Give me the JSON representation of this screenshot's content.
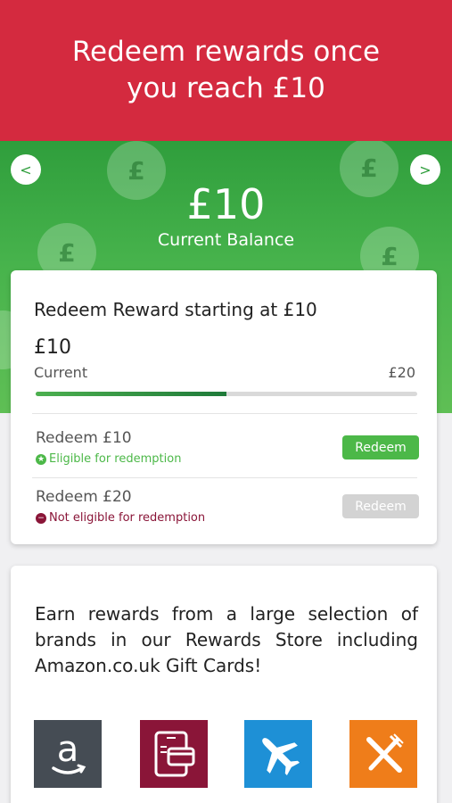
{
  "banner": {
    "title": "Redeem rewards once you reach £10"
  },
  "hero": {
    "prev_label": "<",
    "next_label": ">",
    "balance_amount": "£10",
    "balance_label": "Current Balance",
    "coin_symbol": "£",
    "color": "#47b34c"
  },
  "progress_card": {
    "title": "Redeem Reward starting at £10",
    "current_amount": "£10",
    "current_label": "Current",
    "target_label": "£20",
    "progress_fraction": 0.5,
    "rows": [
      {
        "title": "Redeem £10",
        "status": "Eligible for redemption",
        "status_icon": "star-icon",
        "eligible": true,
        "button_label": "Redeem",
        "color": "#4cb848"
      },
      {
        "title": "Redeem £20",
        "status": "Not eligible for redemption",
        "status_icon": "minus-icon",
        "eligible": false,
        "button_label": "Redeem",
        "color": "#d3d3d3"
      }
    ]
  },
  "store_card": {
    "description": "Earn rewards from a large selection of brands in our Rewards Store including Amazon.co.uk Gift Cards!",
    "brands": [
      {
        "icon": "amazon-icon",
        "color": "#454c54"
      },
      {
        "icon": "mobile-card-icon",
        "color": "#8a1538"
      },
      {
        "icon": "airplane-icon",
        "color": "#1e90d6"
      },
      {
        "icon": "restaurant-icon",
        "color": "#ef7d1a"
      }
    ]
  },
  "colors": {
    "eligible_text": "#4cb848",
    "not_eligible_text": "#8a1538",
    "banner": "#d42a3f"
  }
}
